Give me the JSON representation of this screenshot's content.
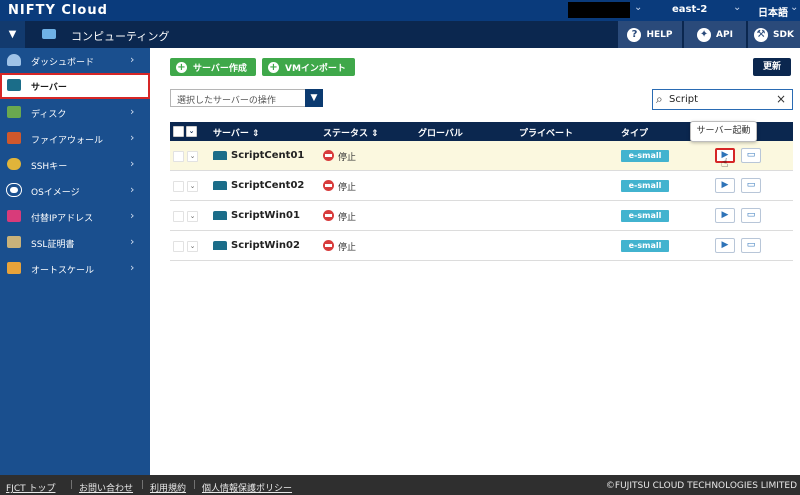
{
  "app": {
    "brand": "NIFTY Cloud",
    "region": "east-2",
    "language": "日本語"
  },
  "subbar": {
    "section": "コンピューティング",
    "help": "HELP",
    "api": "API",
    "sdk": "SDK"
  },
  "sidebar": {
    "items": [
      {
        "label": "ダッシュボード",
        "icon": "dashboard-icon"
      },
      {
        "label": "サーバー",
        "icon": "server-icon",
        "active": true
      },
      {
        "label": "ディスク",
        "icon": "disk-icon"
      },
      {
        "label": "ファイアウォール",
        "icon": "firewall-icon"
      },
      {
        "label": "SSHキー",
        "icon": "key-icon"
      },
      {
        "label": "OSイメージ",
        "icon": "os-image-icon"
      },
      {
        "label": "付替IPアドレス",
        "icon": "ip-icon"
      },
      {
        "label": "SSL証明書",
        "icon": "certificate-icon"
      },
      {
        "label": "オートスケール",
        "icon": "autoscale-icon"
      }
    ]
  },
  "toolbar": {
    "create_label": "サーバー作成",
    "vm_import_label": "VMインポート",
    "refresh_label": "更新",
    "operations_placeholder": "選択したサーバーの操作",
    "search_value": "Script"
  },
  "table": {
    "headers": {
      "server": "サーバー ⇕",
      "status": "ステータス ⇕",
      "global": "グローバル",
      "private": "プライベート",
      "type": "タイプ"
    },
    "rows": [
      {
        "name": "ScriptCent01",
        "status": "停止",
        "type": "e-small",
        "highlighted": true
      },
      {
        "name": "ScriptCent02",
        "status": "停止",
        "type": "e-small"
      },
      {
        "name": "ScriptWin01",
        "status": "停止",
        "type": "e-small"
      },
      {
        "name": "ScriptWin02",
        "status": "停止",
        "type": "e-small"
      }
    ]
  },
  "tooltip": "サーバー起動",
  "footer": {
    "links": [
      "FJCT トップ",
      "お問い合わせ",
      "利用規約",
      "個人情報保護ポリシー"
    ],
    "copyright": "©FUJITSU CLOUD TECHNOLOGIES LIMITED"
  },
  "colors": {
    "topbar": "#0a3b7c",
    "subbar": "#0b274f",
    "sidebar": "#1a4f8e",
    "green": "#3fa84a",
    "type_badge": "#42b3cf",
    "stop": "#d83b3b",
    "highlight_border": "#d62626"
  }
}
